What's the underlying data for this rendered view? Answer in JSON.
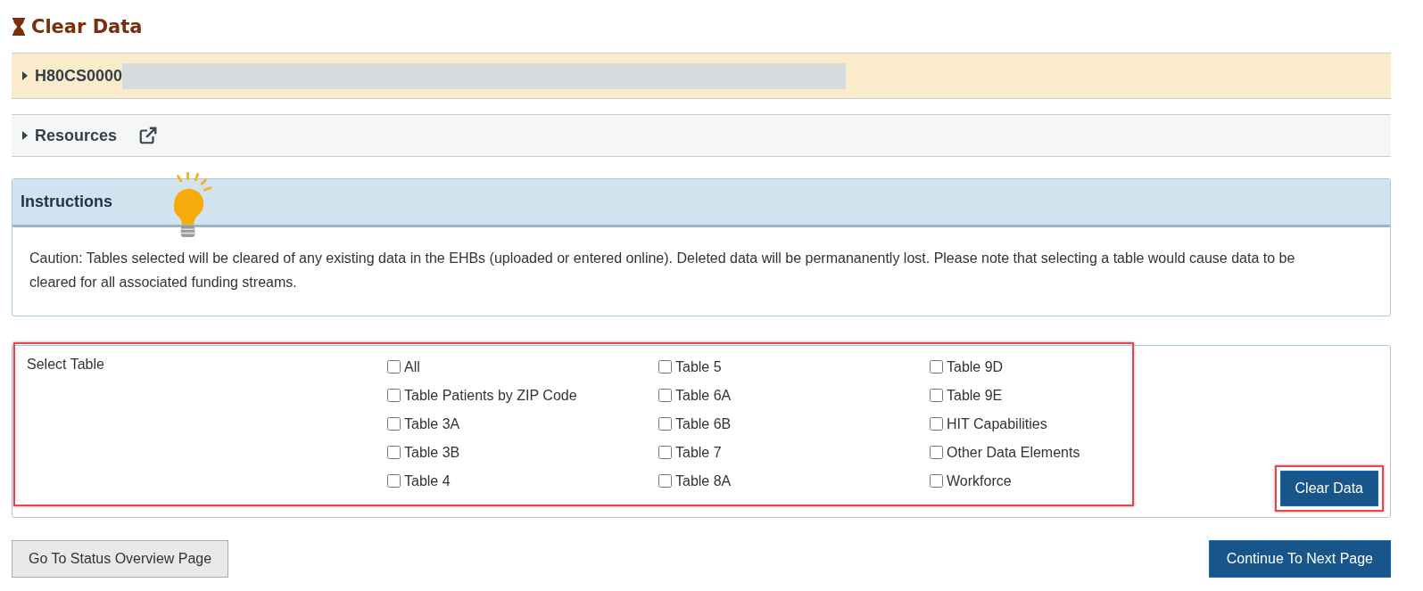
{
  "page_title": "Clear Data",
  "grant_panel": {
    "label": "H80CS0000",
    "expanded": false
  },
  "resources_panel": {
    "label": "Resources",
    "expanded": false
  },
  "instructions": {
    "heading": "Instructions",
    "text": "Caution: Tables selected will be cleared of any existing data in the EHBs (uploaded or entered online). Deleted data will be permananently lost. Please note that selecting a table would cause data to be cleared for all associated funding streams."
  },
  "select_table": {
    "label": "Select Table",
    "columns": [
      [
        {
          "label": "All",
          "checked": false
        },
        {
          "label": "Table Patients by ZIP Code",
          "checked": false
        },
        {
          "label": "Table 3A",
          "checked": false
        },
        {
          "label": "Table 3B",
          "checked": false
        },
        {
          "label": "Table 4",
          "checked": false
        }
      ],
      [
        {
          "label": "Table 5",
          "checked": false
        },
        {
          "label": "Table 6A",
          "checked": false
        },
        {
          "label": "Table 6B",
          "checked": false
        },
        {
          "label": "Table 7",
          "checked": false
        },
        {
          "label": "Table 8A",
          "checked": false
        }
      ],
      [
        {
          "label": "Table 9D",
          "checked": false
        },
        {
          "label": "Table 9E",
          "checked": false
        },
        {
          "label": "HIT Capabilities",
          "checked": false
        },
        {
          "label": "Other Data Elements",
          "checked": false
        },
        {
          "label": "Workforce",
          "checked": false
        }
      ]
    ],
    "button": "Clear Data"
  },
  "footer": {
    "back_button": "Go To Status Overview Page",
    "next_button": "Continue To Next Page"
  }
}
